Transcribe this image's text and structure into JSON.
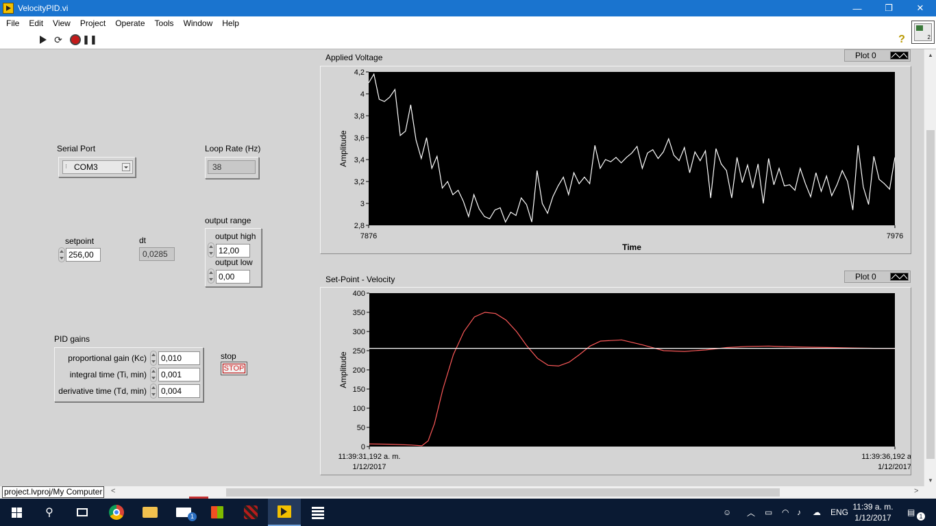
{
  "window": {
    "title": "VelocityPID.vi",
    "minimize": "—",
    "maximize": "❐",
    "close": "✕"
  },
  "menu": [
    "File",
    "Edit",
    "View",
    "Project",
    "Operate",
    "Tools",
    "Window",
    "Help"
  ],
  "toolbar": {
    "help_glyph": "?"
  },
  "controls": {
    "serial_port": {
      "label": "Serial Port",
      "value": "COM3"
    },
    "loop_rate": {
      "label": "Loop Rate (Hz)",
      "value": "38"
    },
    "setpoint": {
      "label": "setpoint",
      "value": "256,00"
    },
    "dt": {
      "label": "dt",
      "value": "0,0285"
    },
    "output_range": {
      "label": "output range",
      "high_label": "output high",
      "high_value": "12,00",
      "low_label": "output low",
      "low_value": "0,00"
    },
    "pid_gains": {
      "label": "PID gains",
      "kc_label": "proportional gain (Kc)",
      "kc_value": "0,010",
      "ti_label": "integral time (Ti, min)",
      "ti_value": "0,001",
      "td_label": "derivative time (Td, min)",
      "td_value": "0,004"
    },
    "stop": {
      "label": "stop",
      "button": "STOP"
    }
  },
  "chart_data": [
    {
      "type": "line",
      "title": "Applied Voltage",
      "xlabel": "Time",
      "ylabel": "Amplitude",
      "xlim": [
        7876,
        7976
      ],
      "ylim": [
        2.8,
        4.2
      ],
      "x_tick_labels": [
        "7876",
        "7976"
      ],
      "y_tick_labels": [
        "2,8",
        "3",
        "3,2",
        "3,4",
        "3,6",
        "3,8",
        "4",
        "4,2"
      ],
      "legend": {
        "position": "top-right",
        "entries": [
          "Plot 0"
        ]
      },
      "series": [
        {
          "color": "#ffffff",
          "x": [
            7876,
            7877,
            7878,
            7879,
            7880,
            7881,
            7882,
            7883,
            7884,
            7885,
            7886,
            7887,
            7888,
            7889,
            7890,
            7891,
            7892,
            7893,
            7894,
            7895,
            7896,
            7897,
            7898,
            7899,
            7900,
            7901,
            7902,
            7903,
            7904,
            7905,
            7906,
            7907,
            7908,
            7909,
            7910,
            7911,
            7912,
            7913,
            7914,
            7915,
            7916,
            7917,
            7918,
            7919,
            7920,
            7921,
            7922,
            7923,
            7924,
            7925,
            7926,
            7927,
            7928,
            7929,
            7930,
            7931,
            7932,
            7933,
            7934,
            7935,
            7936,
            7937,
            7938,
            7939,
            7940,
            7941,
            7942,
            7943,
            7944,
            7945,
            7946,
            7947,
            7948,
            7949,
            7950,
            7951,
            7952,
            7953,
            7954,
            7955,
            7956,
            7957,
            7958,
            7959,
            7960,
            7961,
            7962,
            7963,
            7964,
            7965,
            7966,
            7967,
            7968,
            7969,
            7970,
            7971,
            7972,
            7973,
            7974,
            7975,
            7976
          ],
          "y": [
            4.1,
            4.18,
            3.95,
            3.93,
            3.97,
            4.04,
            3.62,
            3.66,
            3.9,
            3.58,
            3.41,
            3.6,
            3.32,
            3.43,
            3.14,
            3.2,
            3.08,
            3.12,
            3.02,
            2.88,
            3.08,
            2.95,
            2.88,
            2.86,
            2.94,
            2.96,
            2.83,
            2.92,
            2.89,
            3.05,
            2.99,
            2.83,
            3.3,
            3.0,
            2.91,
            3.06,
            3.16,
            3.24,
            3.08,
            3.28,
            3.18,
            3.24,
            3.18,
            3.53,
            3.32,
            3.4,
            3.38,
            3.42,
            3.37,
            3.42,
            3.46,
            3.52,
            3.32,
            3.46,
            3.49,
            3.41,
            3.47,
            3.59,
            3.44,
            3.39,
            3.51,
            3.28,
            3.47,
            3.39,
            3.48,
            3.05,
            3.5,
            3.36,
            3.3,
            3.05,
            3.42,
            3.19,
            3.35,
            3.14,
            3.36,
            3.0,
            3.41,
            3.17,
            3.32,
            3.16,
            3.17,
            3.12,
            3.32,
            3.18,
            3.06,
            3.28,
            3.11,
            3.25,
            3.07,
            3.17,
            3.3,
            3.2,
            2.94,
            3.53,
            3.15,
            2.99,
            3.43,
            3.22,
            3.18,
            3.13,
            3.42
          ]
        }
      ]
    },
    {
      "type": "line",
      "title": "Set-Point - Velocity",
      "xlabel": "",
      "ylabel": "Amplitude",
      "xlim": [
        0,
        5
      ],
      "ylim": [
        0,
        400
      ],
      "x_tick_labels": [
        {
          "time": "11:39:31,192 a. m.",
          "date": "1/12/2017"
        },
        {
          "time": "11:39:36,192 a",
          "date": "1/12/2017"
        }
      ],
      "y_tick_labels": [
        "0",
        "50",
        "100",
        "150",
        "200",
        "250",
        "300",
        "350",
        "400"
      ],
      "legend": {
        "position": "top-right",
        "entries": [
          "Plot 0"
        ]
      },
      "series": [
        {
          "color": "#ff5a5a",
          "x": [
            0,
            0.2,
            0.4,
            0.5,
            0.56,
            0.62,
            0.7,
            0.8,
            0.9,
            1.0,
            1.1,
            1.2,
            1.3,
            1.4,
            1.5,
            1.6,
            1.7,
            1.8,
            1.9,
            2.0,
            2.1,
            2.2,
            2.4,
            2.6,
            2.8,
            3.0,
            3.2,
            3.4,
            3.6,
            3.8,
            4.0,
            4.2,
            4.4,
            4.6,
            4.8,
            5.0
          ],
          "y": [
            7,
            6,
            4,
            2,
            15,
            60,
            150,
            240,
            300,
            338,
            350,
            347,
            330,
            300,
            262,
            230,
            212,
            210,
            220,
            240,
            262,
            275,
            278,
            265,
            250,
            248,
            252,
            258,
            261,
            262,
            260,
            259,
            258,
            257,
            256,
            256
          ]
        },
        {
          "color": "#ffffff",
          "x": [
            0,
            5
          ],
          "y": [
            256,
            256
          ]
        }
      ]
    }
  ],
  "status": {
    "path": "project.lvproj/My Computer"
  },
  "taskbar": {
    "clock_time": "11:39 a. m.",
    "clock_date": "1/12/2017",
    "language": "ENG",
    "notifications_badge": "1",
    "mail_badge": "1"
  }
}
